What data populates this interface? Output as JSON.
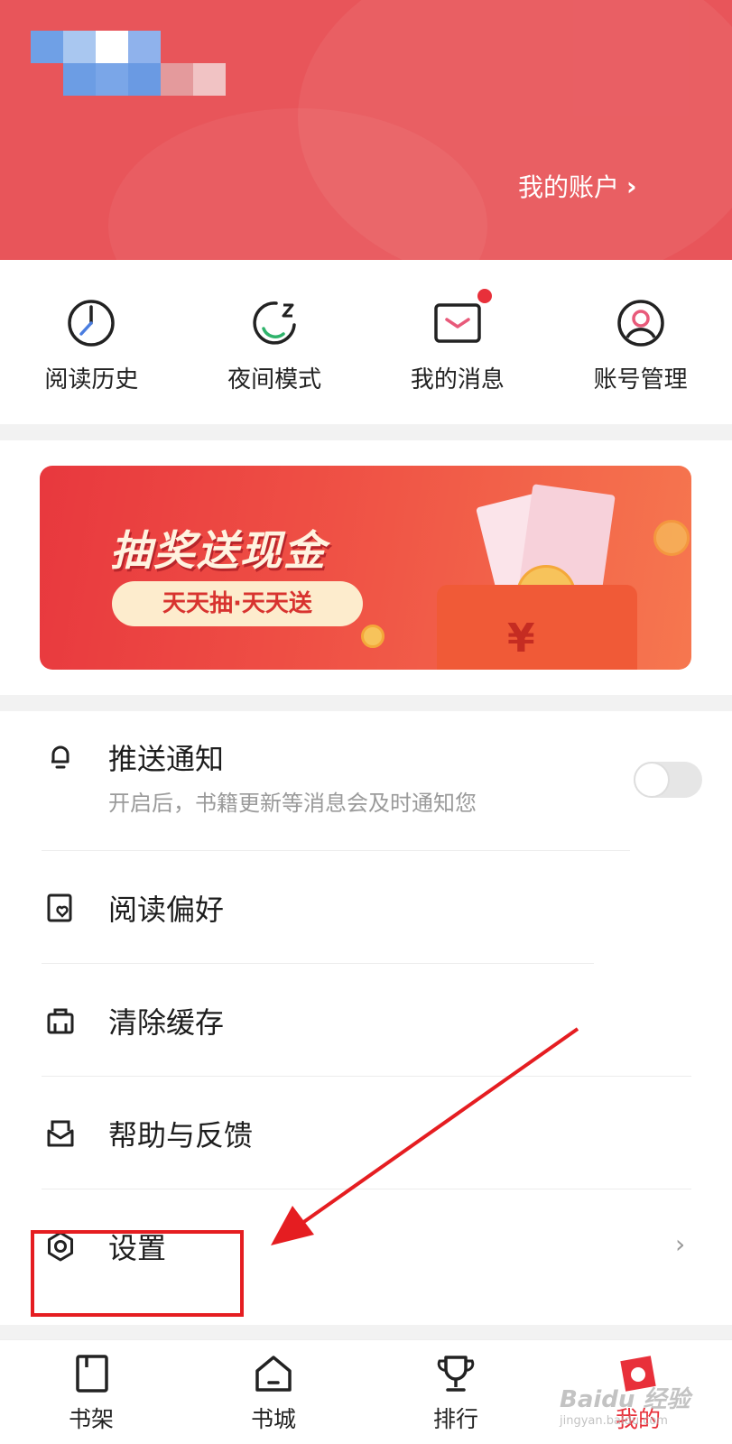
{
  "colors": {
    "brand": "#e8555a",
    "accent": "#e8303a",
    "annotation": "#e51d21"
  },
  "header": {
    "account_label": "我的账户",
    "account_chevron": "›"
  },
  "quick_actions": [
    {
      "label": "阅读历史",
      "icon": "clock-icon"
    },
    {
      "label": "夜间模式",
      "icon": "moon-icon"
    },
    {
      "label": "我的消息",
      "icon": "mail-icon",
      "badge": true
    },
    {
      "label": "账号管理",
      "icon": "user-icon"
    }
  ],
  "banner": {
    "title": "抽奖送现金",
    "subtitle": "天天抽·天天送",
    "currency_symbol": "¥"
  },
  "settings": {
    "push": {
      "title": "推送通知",
      "subtitle": "开启后，书籍更新等消息会及时通知您",
      "enabled": false
    },
    "reading": {
      "title": "阅读偏好"
    },
    "cache": {
      "title": "清除缓存"
    },
    "help": {
      "title": "帮助与反馈"
    },
    "settings": {
      "title": "设置",
      "chevron": "›"
    }
  },
  "bottom_nav": [
    {
      "label": "书架",
      "icon": "bookshelf-icon"
    },
    {
      "label": "书城",
      "icon": "store-icon"
    },
    {
      "label": "排行",
      "icon": "trophy-icon"
    },
    {
      "label": "我的",
      "icon": "profile-icon",
      "active": true
    }
  ],
  "watermark": {
    "text": "Baidu 经验",
    "sub": "jingyan.baidu.com"
  }
}
